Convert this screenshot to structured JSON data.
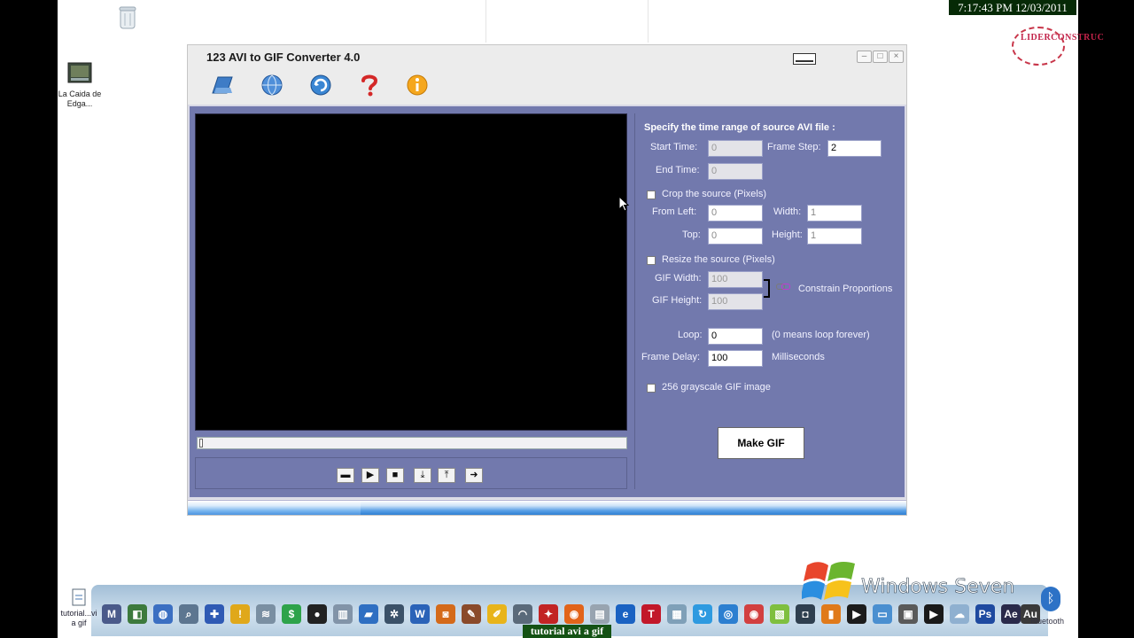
{
  "clock": "7:17:43 PM 12/03/2011",
  "stamp_text": "LIDERCONSTRUC",
  "desktop": {
    "icon1_label": "La Caida de Edga..."
  },
  "window": {
    "title": "123 AVI to GIF Converter 4.0"
  },
  "toolbar_icons": [
    "folder-icon",
    "globe-icon",
    "refresh-icon",
    "help-icon",
    "info-icon"
  ],
  "form": {
    "heading": "Specify the time range of source AVI file :",
    "start_time_label": "Start Time:",
    "start_time_value": "0",
    "frame_step_label": "Frame Step:",
    "frame_step_value": "2",
    "end_time_label": "End Time:",
    "end_time_value": "0",
    "crop_label": "Crop the source  (Pixels)",
    "from_left_label": "From  Left:",
    "from_left_value": "0",
    "width_label": "Width:",
    "width_value": "1",
    "top_label": "Top:",
    "top_value": "0",
    "height_label": "Height:",
    "height_value": "1",
    "resize_label": "Resize the source  (Pixels)",
    "gif_width_label": "GIF Width:",
    "gif_width_value": "100",
    "gif_height_label": "GIF Height:",
    "gif_height_value": "100",
    "constrain_label": "Constrain Proportions",
    "loop_label": "Loop:",
    "loop_value": "0",
    "loop_hint": "(0 means loop forever)",
    "frame_delay_label": "Frame Delay:",
    "frame_delay_value": "100",
    "ms_label": "Milliseconds",
    "grayscale_label": "256 grayscale GIF image",
    "make_gif_label": "Make GIF"
  },
  "player_controls": [
    "open-icon",
    "play-icon",
    "stop-icon",
    "mark-in-icon",
    "mark-out-icon",
    "next-icon"
  ],
  "progress_fraction": 0.24,
  "taskbar": {
    "brand": "Windows Seven",
    "tutorial_file_label": "tutorial...vi a gif",
    "bluetooth_label": "Bluetooth"
  },
  "caption": "tutorial avi a gif",
  "colors": {
    "panel": "#7279ad",
    "clock_bg": "#062a06",
    "progress": "#5aa0e6"
  }
}
